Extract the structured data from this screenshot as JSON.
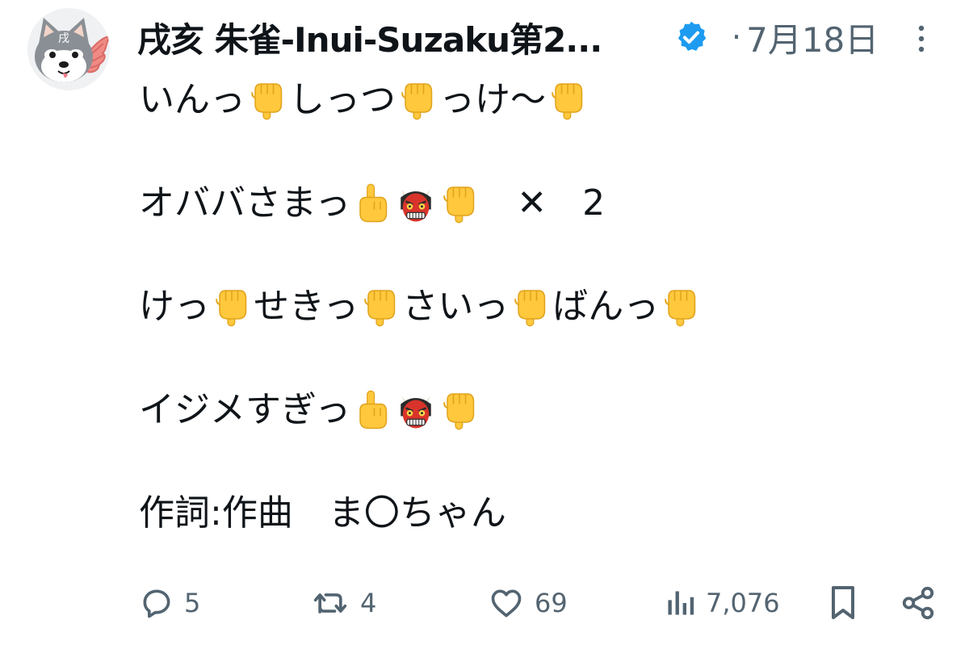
{
  "author": {
    "display_name": "戌亥 朱雀-Inui-Suzaku第2...",
    "avatar_kanji": "戌",
    "verified": true,
    "separator": "·",
    "date": "7月18日"
  },
  "post": {
    "lines": [
      {
        "parts": [
          {
            "t": "いんっ"
          },
          {
            "e": "pointing-down-hand"
          },
          {
            "t": "しっつ"
          },
          {
            "e": "pointing-down-hand"
          },
          {
            "t": "っけ〜"
          },
          {
            "e": "pointing-down-hand"
          }
        ]
      },
      {
        "parts": [
          {
            "t": "オババさまっ"
          },
          {
            "e": "index-pointing-up"
          },
          {
            "e": "ogre-face"
          },
          {
            "e": "pointing-down-hand"
          },
          {
            "t": "　✕　2"
          }
        ]
      },
      {
        "parts": [
          {
            "t": "けっ"
          },
          {
            "e": "pointing-down-hand"
          },
          {
            "t": "せきっ"
          },
          {
            "e": "pointing-down-hand"
          },
          {
            "t": "さいっ"
          },
          {
            "e": "pointing-down-hand"
          },
          {
            "t": "ばんっ"
          },
          {
            "e": "pointing-down-hand"
          }
        ]
      },
      {
        "parts": [
          {
            "t": "イジメすぎっ"
          },
          {
            "e": "index-pointing-up"
          },
          {
            "e": "ogre-face"
          },
          {
            "e": "pointing-down-hand"
          }
        ]
      },
      {
        "parts": [
          {
            "t": "作詞:作曲　ま〇ちゃん"
          }
        ]
      }
    ]
  },
  "actions": {
    "replies": "5",
    "reposts": "4",
    "likes": "69",
    "views": "7,076"
  },
  "colors": {
    "text": "#0f1419",
    "muted": "#536471",
    "verified_blue": "#1d9bf0",
    "emoji_skin": "#ffc83d",
    "ogre_red": "#d9342b"
  }
}
